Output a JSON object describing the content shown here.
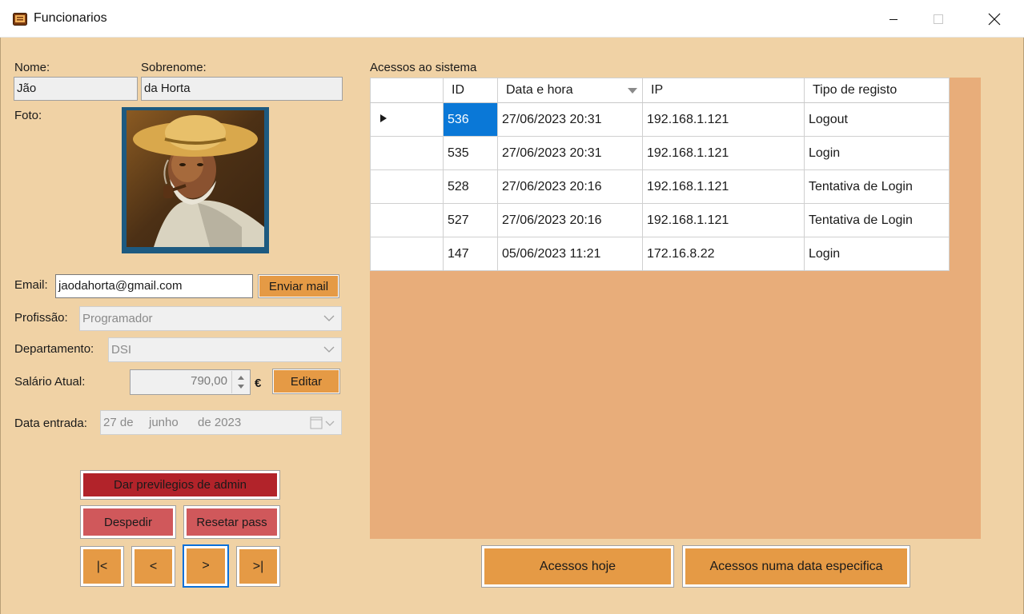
{
  "window": {
    "title": "Funcionarios"
  },
  "form": {
    "nome_label": "Nome:",
    "nome_value": "Jão",
    "sobrenome_label": "Sobrenome:",
    "sobrenome_value": "da Horta",
    "foto_label": "Foto:",
    "email_label": "Email:",
    "email_value": "jaodahorta@gmail.com",
    "enviar_mail_label": "Enviar mail",
    "profissao_label": "Profissão:",
    "profissao_value": "Programador",
    "departamento_label": "Departamento:",
    "departamento_value": "DSI",
    "salario_label": "Salário Atual:",
    "salario_value": "790,00",
    "currency": "€",
    "editar_label": "Editar",
    "data_entrada_label": "Data entrada:",
    "data_day": "27 de",
    "data_month": "junho",
    "data_year": "de 2023"
  },
  "actions": {
    "admin_label": "Dar previlegios de admin",
    "despedir_label": "Despedir",
    "resetar_label": "Resetar pass",
    "nav_first": "|<",
    "nav_prev": "<",
    "nav_next": ">",
    "nav_last": ">|"
  },
  "accesses": {
    "title": "Acessos ao sistema",
    "columns": [
      "ID",
      "Data e hora",
      "IP",
      "Tipo de registo"
    ],
    "rows": [
      {
        "id": "536",
        "datetime": "27/06/2023 20:31",
        "ip": "192.168.1.121",
        "tipo": "Logout"
      },
      {
        "id": "535",
        "datetime": "27/06/2023 20:31",
        "ip": "192.168.1.121",
        "tipo": "Login"
      },
      {
        "id": "528",
        "datetime": "27/06/2023 20:16",
        "ip": "192.168.1.121",
        "tipo": "Tentativa de Login"
      },
      {
        "id": "527",
        "datetime": "27/06/2023 20:16",
        "ip": "192.168.1.121",
        "tipo": "Tentativa de Login"
      },
      {
        "id": "147",
        "datetime": "05/06/2023 11:21",
        "ip": "172.16.8.22",
        "tipo": "Login"
      }
    ],
    "hoje_label": "Acessos hoje",
    "data_especifica_label": "Acessos numa data especifica"
  }
}
